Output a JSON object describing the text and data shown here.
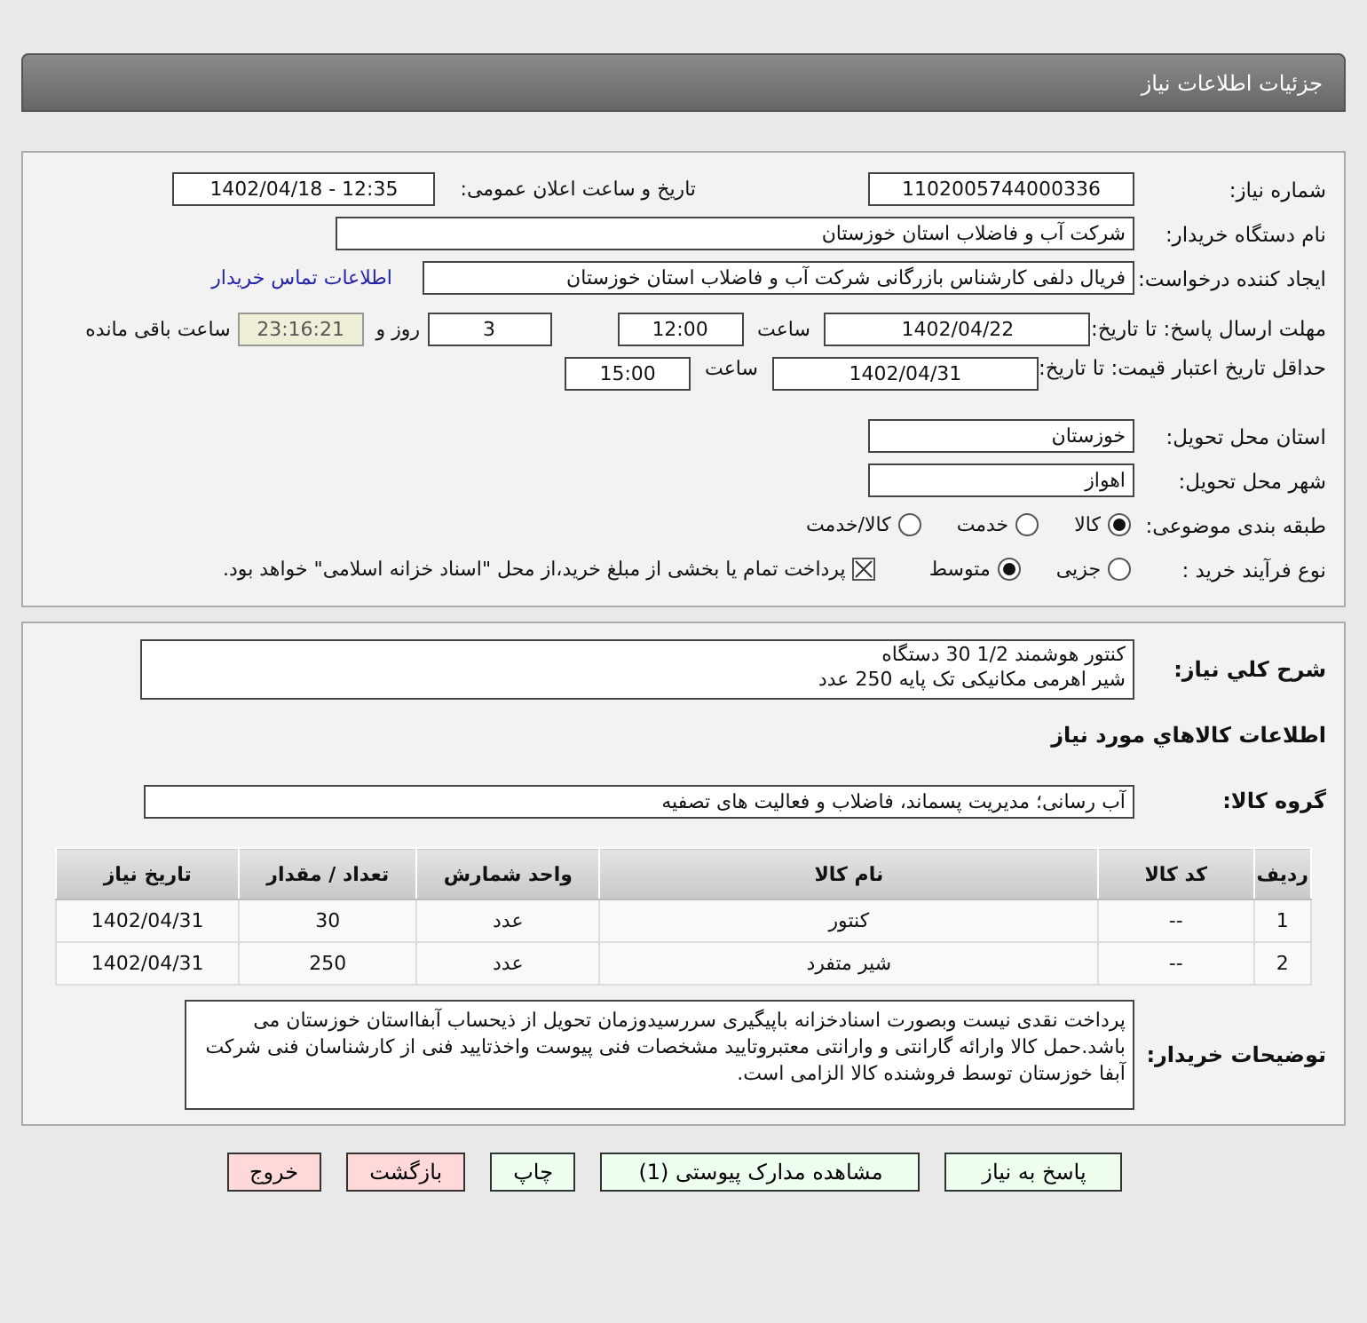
{
  "header": {
    "title": "جزئیات اطلاعات نیاز"
  },
  "need_number": {
    "label": "شماره نیاز:",
    "value": "1102005744000336"
  },
  "announce": {
    "label": "تاریخ و ساعت اعلان عمومی:",
    "value": "1402/04/18 - 12:35"
  },
  "buyer_org": {
    "label": "نام دستگاه خریدار:",
    "value": "شرکت آب و فاضلاب استان خوزستان"
  },
  "requester": {
    "label": "ایجاد کننده درخواست:",
    "value": "فریال دلفی کارشناس بازرگانی شرکت آب و فاضلاب استان خوزستان",
    "link": "اطلاعات تماس خریدار"
  },
  "deadline": {
    "label": "مهلت ارسال پاسخ: تا تاریخ:",
    "date": "1402/04/22",
    "time_label": "ساعت",
    "time": "12:00",
    "days": "3",
    "days_label": "روز و",
    "remaining": "23:16:21",
    "remaining_label": "ساعت باقی مانده"
  },
  "validity": {
    "label": "حداقل تاریخ اعتبار قیمت: تا تاریخ:",
    "date": "1402/04/31",
    "time_label": "ساعت",
    "time": "15:00"
  },
  "province": {
    "label": "استان محل تحویل:",
    "value": "خوزستان"
  },
  "city": {
    "label": "شهر محل تحویل:",
    "value": "اهواز"
  },
  "category": {
    "label": "طبقه بندی موضوعی:",
    "options": [
      {
        "label": "کالا",
        "selected": true
      },
      {
        "label": "خدمت",
        "selected": false
      },
      {
        "label": "کالا/خدمت",
        "selected": false
      }
    ]
  },
  "process": {
    "label": "نوع فرآیند خرید :",
    "options": [
      {
        "label": "جزیی",
        "selected": false
      },
      {
        "label": "متوسط",
        "selected": true
      }
    ],
    "payment": {
      "checked": true,
      "text": "پرداخت تمام یا بخشی از مبلغ خرید،از محل \"اسناد خزانه اسلامی\" خواهد بود."
    }
  },
  "summary": {
    "label": "شرح کلي نياز:",
    "lines": [
      "کنتور هوشمند 1/2 30 دستگاه",
      "شیر اهرمی مکانیکی تک پایه 250 عدد"
    ]
  },
  "goods_title": "اطلاعات کالاهاي مورد نياز",
  "goods_group": {
    "label": "گروه کالا:",
    "value": "آب رسانی؛ مدیریت پسماند، فاضلاب و فعالیت های تصفیه"
  },
  "table": {
    "columns": [
      "ردیف",
      "کد کالا",
      "نام کالا",
      "واحد شمارش",
      "تعداد / مقدار",
      "تاریخ نیاز"
    ],
    "rows": [
      [
        "1",
        "--",
        "کنتور",
        "عدد",
        "30",
        "1402/04/31"
      ],
      [
        "2",
        "--",
        "شیر متفرد",
        "عدد",
        "250",
        "1402/04/31"
      ]
    ]
  },
  "buyer_notes": {
    "label": "توضیحات خریدار:",
    "text": "پرداخت نقدی نیست وبصورت اسنادخزانه باپیگیری سررسیدوزمان تحویل از ذیحساب آبفااستان خوزستان می باشد.حمل کالا وارائه گارانتی و وارانتی معتبروتایید مشخصات فنی پیوست واخذتایید فنی از کارشناسان فنی شرکت آبفا خوزستان توسط فروشنده کالا الزامی است."
  },
  "buttons": [
    {
      "label": "پاسخ به نیاز",
      "kind": "action"
    },
    {
      "label": "مشاهده مدارک پیوستی (1)",
      "kind": "action"
    },
    {
      "label": "چاپ",
      "kind": "action"
    },
    {
      "label": "بازگشت",
      "kind": "exit"
    },
    {
      "label": "خروج",
      "kind": "exit"
    }
  ]
}
